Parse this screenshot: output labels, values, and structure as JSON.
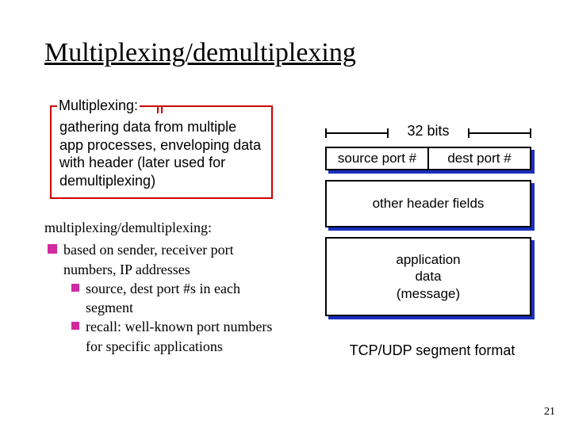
{
  "title": "Multiplexing/demultiplexing",
  "mux": {
    "legend": "Multiplexing:",
    "body": "gathering data from multiple app processes, enveloping data with header (later used for demultiplexing)"
  },
  "bullets": {
    "lead": "multiplexing/demultiplexing:",
    "l1": "based on sender, receiver port numbers, IP addresses",
    "l2a": "source, dest port #s in each segment",
    "l2b": "recall: well-known port numbers for specific applications"
  },
  "segment": {
    "bits": "32 bits",
    "srcport": "source port #",
    "dstport": "dest port #",
    "other": "other header fields",
    "data": "application\ndata\n(message)",
    "caption": "TCP/UDP segment format"
  },
  "pagenum": "21"
}
